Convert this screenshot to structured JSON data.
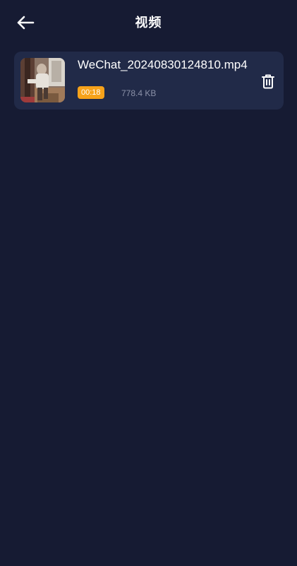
{
  "header": {
    "title": "视频",
    "back_icon": "arrow-left-icon"
  },
  "videos": [
    {
      "file_name": "WeChat_20240830124810.mp4",
      "duration": "00:18",
      "size": "778.4 KB",
      "thumbnail_icon": "video-thumbnail",
      "delete_icon": "trash-icon"
    }
  ],
  "colors": {
    "background": "#161b33",
    "card": "#212a48",
    "badge": "#f7a21a",
    "muted_text": "#8b91a8"
  }
}
